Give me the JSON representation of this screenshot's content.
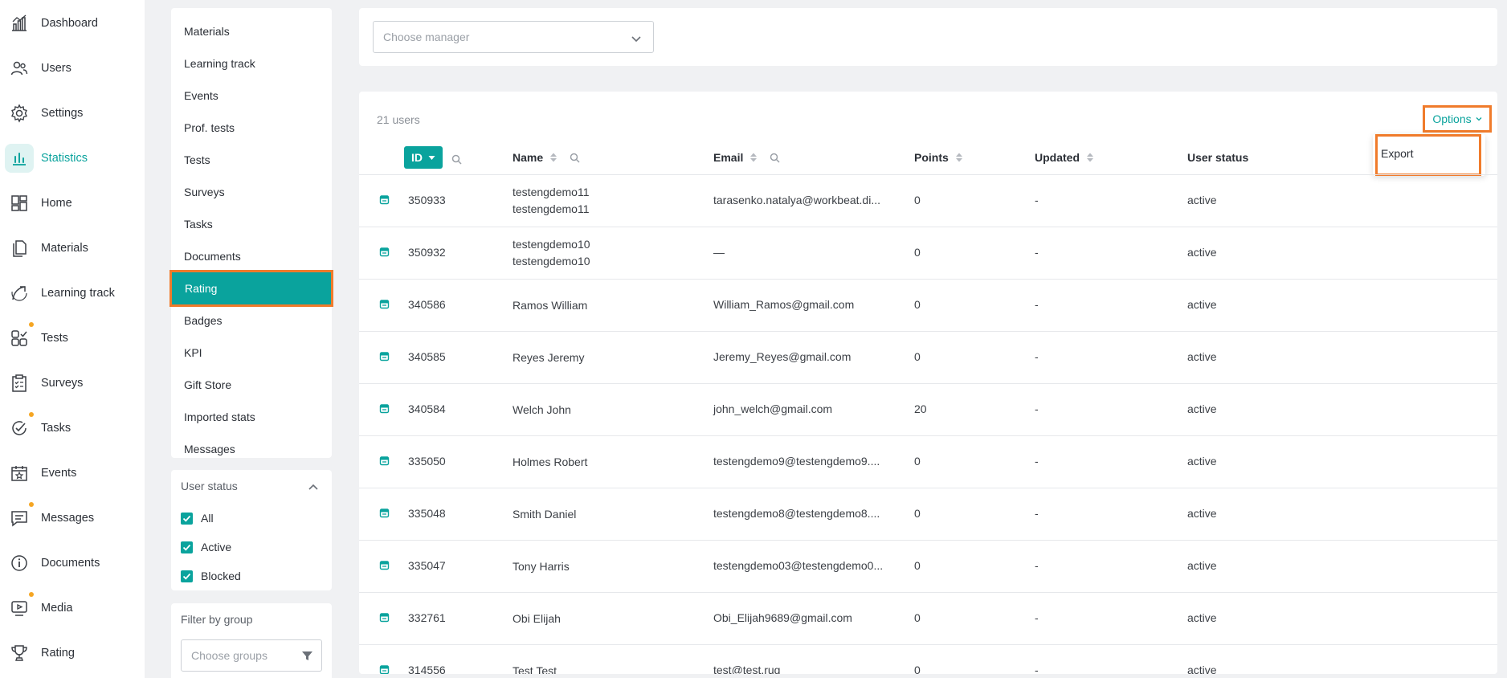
{
  "app_nav": [
    {
      "label": "Dashboard",
      "icon": "dashboard-chart-icon",
      "active": false,
      "dot": false
    },
    {
      "label": "Users",
      "icon": "users-icon",
      "active": false,
      "dot": false
    },
    {
      "label": "Settings",
      "icon": "gear-icon",
      "active": false,
      "dot": false
    },
    {
      "label": "Statistics",
      "icon": "bar-chart-icon",
      "active": true,
      "dot": false
    },
    {
      "label": "Home",
      "icon": "home-grid-icon",
      "active": false,
      "dot": false
    },
    {
      "label": "Materials",
      "icon": "document-copy-icon",
      "active": false,
      "dot": false
    },
    {
      "label": "Learning track",
      "icon": "track-arrow-icon",
      "active": false,
      "dot": false
    },
    {
      "label": "Tests",
      "icon": "tests-grid-icon",
      "active": false,
      "dot": true
    },
    {
      "label": "Surveys",
      "icon": "clipboard-icon",
      "active": false,
      "dot": false
    },
    {
      "label": "Tasks",
      "icon": "check-circle-icon",
      "active": false,
      "dot": true
    },
    {
      "label": "Events",
      "icon": "calendar-star-icon",
      "active": false,
      "dot": false
    },
    {
      "label": "Messages",
      "icon": "chat-icon",
      "active": false,
      "dot": true
    },
    {
      "label": "Documents",
      "icon": "info-circle-icon",
      "active": false,
      "dot": false
    },
    {
      "label": "Media",
      "icon": "play-screen-icon",
      "active": false,
      "dot": true
    },
    {
      "label": "Rating",
      "icon": "trophy-icon",
      "active": false,
      "dot": false
    }
  ],
  "stats_menu": [
    {
      "label": "Materials",
      "active": false
    },
    {
      "label": "Learning track",
      "active": false
    },
    {
      "label": "Events",
      "active": false
    },
    {
      "label": "Prof. tests",
      "active": false
    },
    {
      "label": "Tests",
      "active": false
    },
    {
      "label": "Surveys",
      "active": false
    },
    {
      "label": "Tasks",
      "active": false
    },
    {
      "label": "Documents",
      "active": false
    },
    {
      "label": "Rating",
      "active": true
    },
    {
      "label": "Badges",
      "active": false
    },
    {
      "label": "KPI",
      "active": false
    },
    {
      "label": "Gift Store",
      "active": false
    },
    {
      "label": "Imported stats",
      "active": false
    },
    {
      "label": "Messages",
      "active": false
    }
  ],
  "user_status": {
    "title": "User status",
    "options": [
      {
        "label": "All",
        "checked": true
      },
      {
        "label": "Active",
        "checked": true
      },
      {
        "label": "Blocked",
        "checked": true
      }
    ]
  },
  "group_filter": {
    "title": "Filter by group",
    "placeholder": "Choose groups"
  },
  "manager": {
    "placeholder": "Choose manager"
  },
  "table": {
    "count": "21 users",
    "options_label": "Options",
    "options_menu": [
      "Export"
    ],
    "columns": {
      "id": "ID",
      "name": "Name",
      "email": "Email",
      "points": "Points",
      "updated": "Updated",
      "status": "User status"
    },
    "rows": [
      {
        "id": "350933",
        "name": [
          "testengdemo11",
          "testengdemo11"
        ],
        "email": "tarasenko.natalya@workbeat.di...",
        "points": "0",
        "updated": "-",
        "status": "active"
      },
      {
        "id": "350932",
        "name": [
          "testengdemo10",
          "testengdemo10"
        ],
        "email": "—",
        "points": "0",
        "updated": "-",
        "status": "active"
      },
      {
        "id": "340586",
        "name": [
          "Ramos William"
        ],
        "email": "William_Ramos@gmail.com",
        "points": "0",
        "updated": "-",
        "status": "active"
      },
      {
        "id": "340585",
        "name": [
          "Reyes Jeremy"
        ],
        "email": "Jeremy_Reyes@gmail.com",
        "points": "0",
        "updated": "-",
        "status": "active"
      },
      {
        "id": "340584",
        "name": [
          "Welch John"
        ],
        "email": "john_welch@gmail.com",
        "points": "20",
        "updated": "-",
        "status": "active"
      },
      {
        "id": "335050",
        "name": [
          "Holmes Robert"
        ],
        "email": "testengdemo9@testengdemo9....",
        "points": "0",
        "updated": "-",
        "status": "active"
      },
      {
        "id": "335048",
        "name": [
          "Smith Daniel"
        ],
        "email": "testengdemo8@testengdemo8....",
        "points": "0",
        "updated": "-",
        "status": "active"
      },
      {
        "id": "335047",
        "name": [
          "Tony Harris"
        ],
        "email": "testengdemo03@testengdemo0...",
        "points": "0",
        "updated": "-",
        "status": "active"
      },
      {
        "id": "332761",
        "name": [
          "Obi Elijah"
        ],
        "email": "Obi_Elijah9689@gmail.com",
        "points": "0",
        "updated": "-",
        "status": "active"
      },
      {
        "id": "314556",
        "name": [
          "Test Test"
        ],
        "email": "test@test.rug",
        "points": "0",
        "updated": "-",
        "status": "active"
      }
    ]
  },
  "colors": {
    "accent": "#0aa39d",
    "highlight": "#f07b2b",
    "notification_dot": "#f5a623"
  }
}
